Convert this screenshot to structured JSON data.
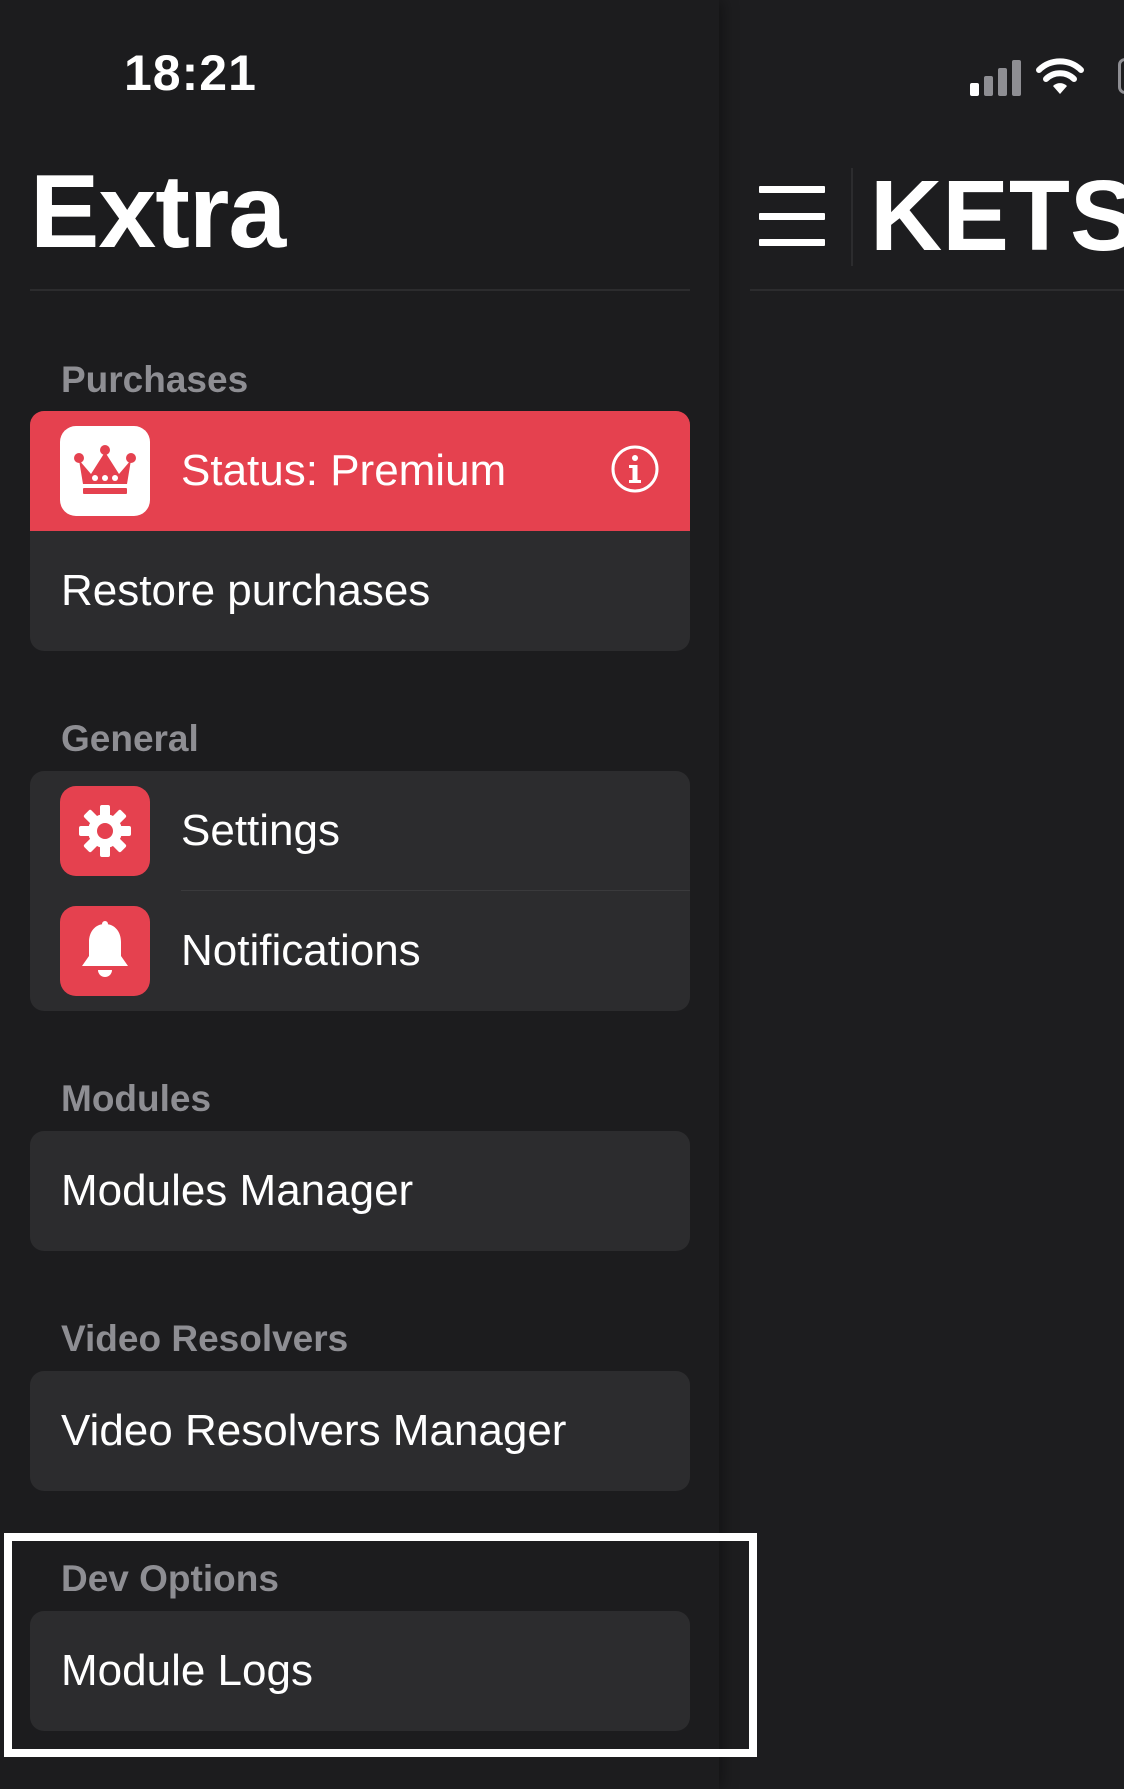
{
  "status_bar": {
    "time": "18:21"
  },
  "sidebar": {
    "title": "Extra",
    "sections": {
      "purchases": {
        "header": "Purchases",
        "status_label": "Status: Premium",
        "restore_label": "Restore purchases"
      },
      "general": {
        "header": "General",
        "settings_label": "Settings",
        "notifications_label": "Notifications"
      },
      "modules": {
        "header": "Modules",
        "manager_label": "Modules Manager"
      },
      "video_resolvers": {
        "header": "Video Resolvers",
        "manager_label": "Video Resolvers Manager"
      },
      "dev_options": {
        "header": "Dev Options",
        "logs_label": "Module Logs"
      }
    }
  },
  "main": {
    "title": "KETS"
  },
  "colors": {
    "accent": "#e5414f",
    "background": "#1c1c1e",
    "cell": "#2c2c2e",
    "secondary_text": "#8e8e93"
  },
  "icons": {
    "premium": "crown-icon",
    "info": "info-icon",
    "settings": "gear-icon",
    "notifications": "bell-icon",
    "menu": "hamburger-menu-icon",
    "signal": "cellular-signal-icon",
    "wifi": "wifi-icon",
    "battery": "battery-icon"
  }
}
